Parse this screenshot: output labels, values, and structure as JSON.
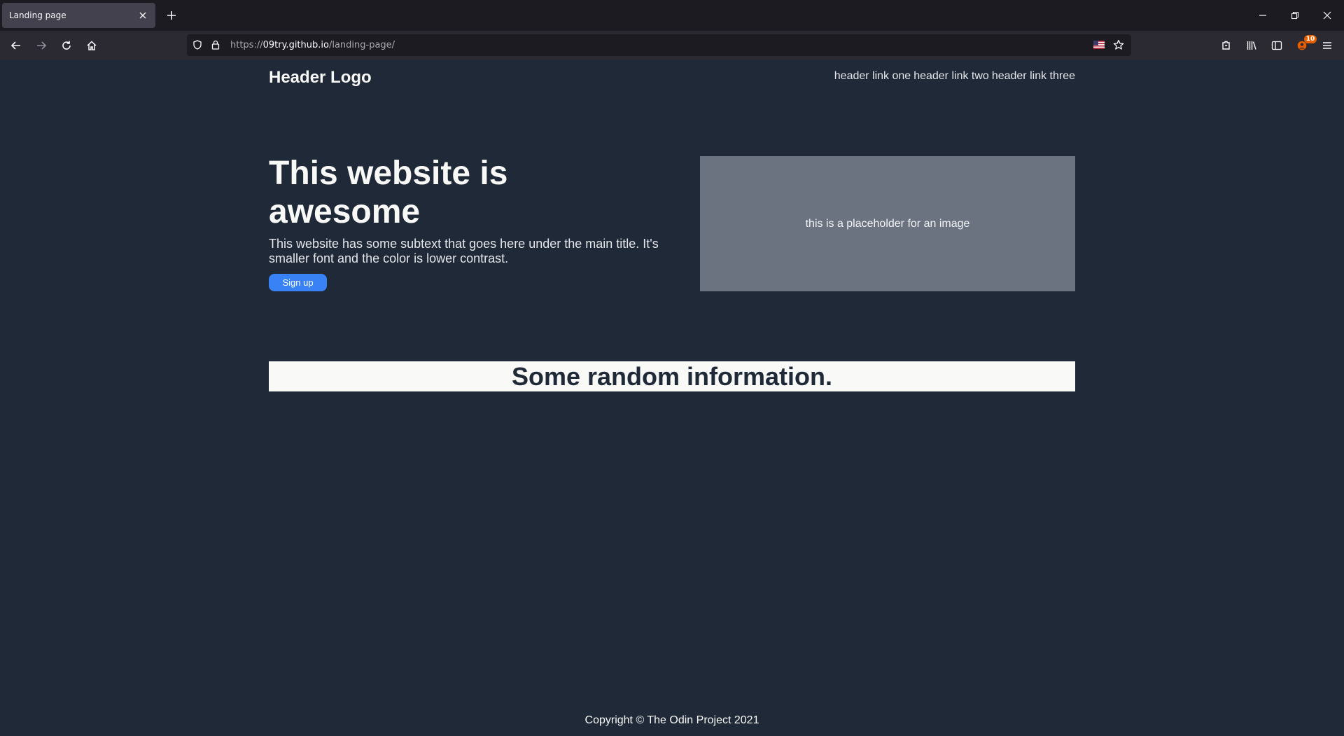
{
  "browser": {
    "tab_title": "Landing page",
    "url_scheme": "https://",
    "url_host": "09try.github.io",
    "url_path": "/landing-page/",
    "notification_count": "10",
    "icons": {
      "tab_close": "close-icon",
      "new_tab": "plus-icon",
      "minimize": "minimize-icon",
      "restore": "restore-icon",
      "close_window": "close-icon",
      "back": "arrow-left-icon",
      "forward": "arrow-right-icon",
      "reload": "reload-icon",
      "home": "home-icon",
      "shield": "shield-icon",
      "lock": "lock-icon",
      "flag": "us-flag-icon",
      "bookmark": "star-icon",
      "extensions": "puzzle-icon",
      "library": "library-icon",
      "sidebar": "sidebar-icon",
      "account": "account-icon",
      "menu": "hamburger-icon"
    }
  },
  "header": {
    "logo": "Header Logo",
    "links": [
      "header link one",
      "header link two",
      "header link three"
    ]
  },
  "hero": {
    "title": "This website is awesome",
    "subtext": "This website has some subtext that goes here under the main title. It's smaller font and the color is lower contrast.",
    "button_label": "Sign up",
    "image_placeholder": "this is a placeholder for an image"
  },
  "info": {
    "heading": "Some random information."
  },
  "footer": {
    "copyright": "Copyright © The Odin Project 2021"
  },
  "colors": {
    "page_bg": "#1f2937",
    "text_light": "#f9faf8",
    "button_blue": "#3882f6",
    "placeholder_gray": "#6b7280"
  }
}
